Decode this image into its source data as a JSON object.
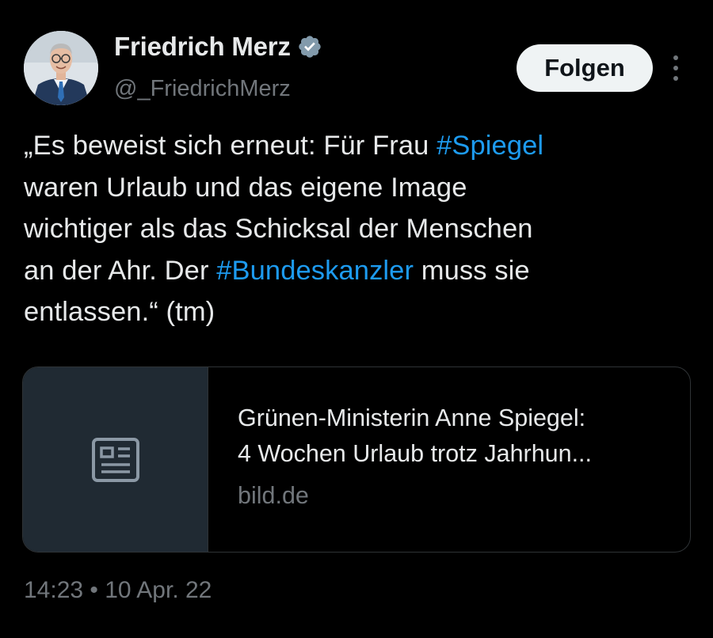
{
  "author": {
    "display_name": "Friedrich Merz",
    "handle": "@_FriedrichMerz",
    "verified": true,
    "verified_icon": "verified-badge-icon",
    "avatar_icon": "profile-photo"
  },
  "actions": {
    "follow_label": "Folgen",
    "more_icon": "more-vertical-icon"
  },
  "tweet": {
    "lines": [
      [
        {
          "text": "„Es beweist sich erneut: Für Frau "
        },
        {
          "text": "#Spiegel",
          "hashtag": true
        }
      ],
      [
        {
          "text": "waren Urlaub und das eigene Image"
        }
      ],
      [
        {
          "text": "wichtiger als das Schicksal der Menschen"
        }
      ],
      [
        {
          "text": "an der Ahr. Der "
        },
        {
          "text": "#Bundeskanzler",
          "hashtag": true
        },
        {
          "text": " muss sie"
        }
      ],
      [
        {
          "text": "entlassen.“ (tm)"
        }
      ]
    ],
    "hashtag_color": "#1d9bf0"
  },
  "card": {
    "icon": "article-icon",
    "title_line1": "Grünen-Ministerin Anne Spiegel:",
    "title_line2": "4 Wochen Urlaub trotz Jahrhun...",
    "domain": "bild.de"
  },
  "meta": {
    "timestamp": "14:23 • 10 Apr. 22"
  }
}
